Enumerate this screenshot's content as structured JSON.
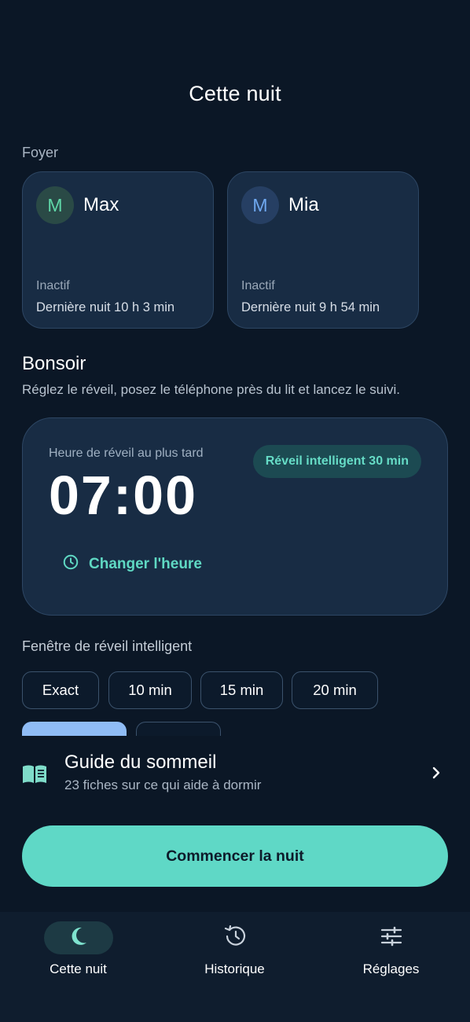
{
  "header": {
    "title": "Cette nuit"
  },
  "household": {
    "label": "Foyer",
    "members": [
      {
        "initial": "M",
        "name": "Max",
        "status": "Inactif",
        "last_night": "Dernière nuit 10 h 3 min",
        "avatar_color": "#2a4a46",
        "initial_color": "#5fd8a8"
      },
      {
        "initial": "M",
        "name": "Mia",
        "status": "Inactif",
        "last_night": "Dernière nuit 9 h 54 min",
        "avatar_color": "#263f63",
        "initial_color": "#6fa8f0"
      }
    ]
  },
  "greeting": {
    "title": "Bonsoir",
    "subtitle": "Réglez le réveil, posez le téléphone près du lit et lancez le suivi."
  },
  "alarm": {
    "label": "Heure de réveil au plus tard",
    "time": "07:00",
    "smart_badge": "Réveil intelligent 30 min",
    "change_label": "Changer l'heure"
  },
  "smart_window": {
    "label": "Fenêtre de réveil intelligent",
    "options": [
      "Exact",
      "10 min",
      "15 min",
      "20 min"
    ]
  },
  "guide": {
    "title": "Guide du sommeil",
    "subtitle": "23 fiches sur ce qui aide à dormir",
    "icon": "book-icon"
  },
  "start_button": "Commencer la nuit",
  "nav": {
    "items": [
      {
        "label": "Cette nuit",
        "icon": "moon-icon",
        "active": true
      },
      {
        "label": "Historique",
        "icon": "history-icon",
        "active": false
      },
      {
        "label": "Réglages",
        "icon": "sliders-icon",
        "active": false
      }
    ]
  },
  "colors": {
    "accent": "#5fd8c6",
    "background": "#0b1726",
    "card": "#182c44",
    "selected_chip": "#8fbcf5"
  }
}
